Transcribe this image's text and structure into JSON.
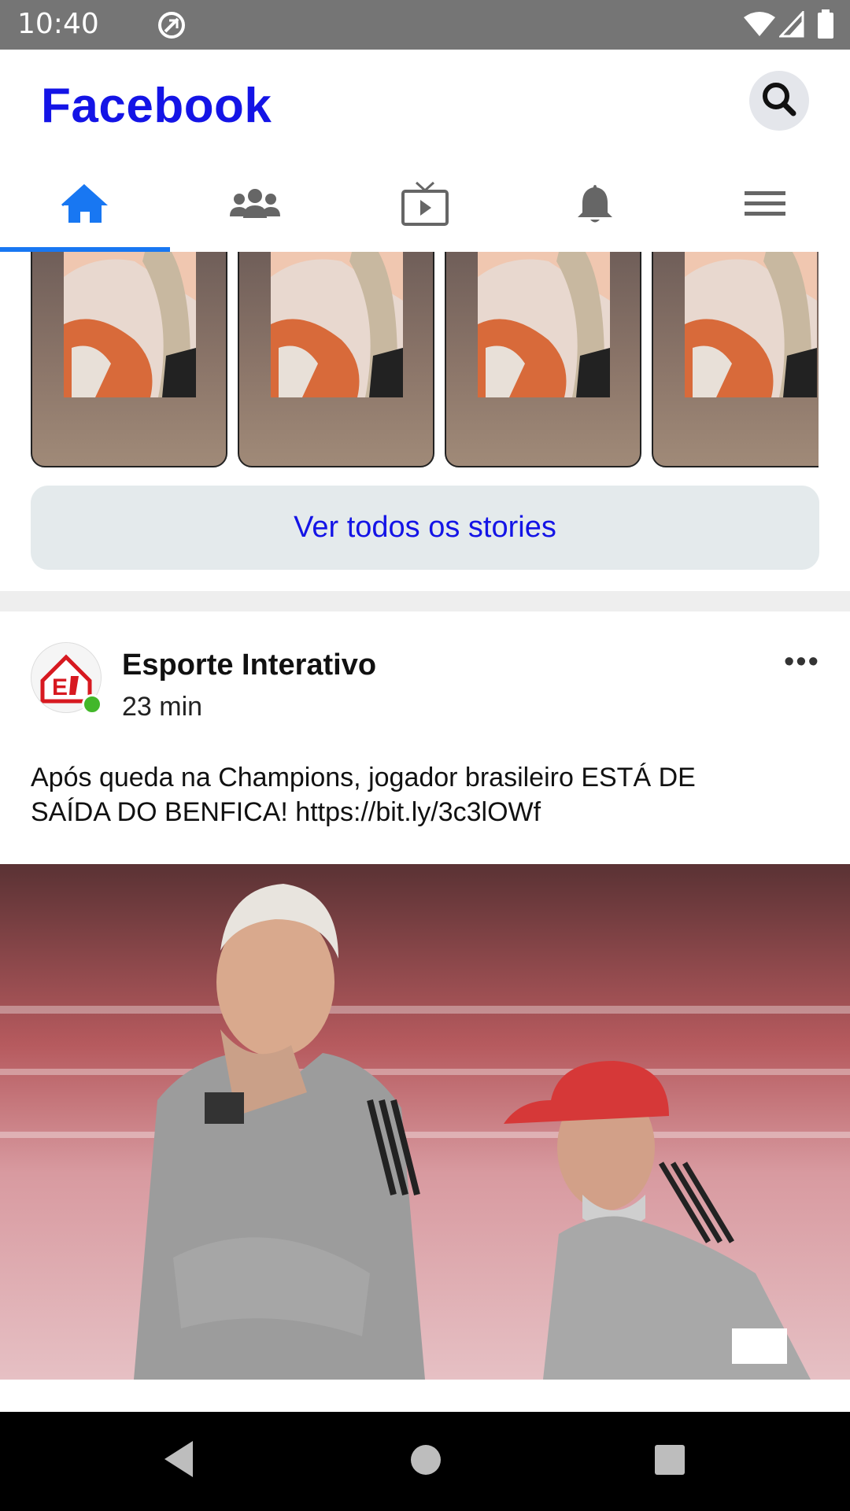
{
  "status_bar": {
    "time": "10:40",
    "icons": [
      "data-saver-icon",
      "wifi-icon",
      "cellular-signal-icon",
      "battery-icon"
    ]
  },
  "header": {
    "title": "Facebook",
    "search_icon": "search-icon",
    "brand_color": "#1414e6"
  },
  "tabs": [
    {
      "name": "home",
      "icon": "home-icon",
      "active": true
    },
    {
      "name": "groups",
      "icon": "people-icon",
      "active": false
    },
    {
      "name": "watch",
      "icon": "tv-play-icon",
      "active": false
    },
    {
      "name": "notifications",
      "icon": "bell-icon",
      "active": false
    },
    {
      "name": "menu",
      "icon": "hamburger-menu-icon",
      "active": false
    }
  ],
  "stories": {
    "see_all_label": "Ver todos os stories"
  },
  "post": {
    "author": "Esporte Interativo",
    "time": "23 min",
    "more_icon": "more-options-icon",
    "text_line1": "Após queda na Champions, jogador brasileiro ESTÁ DE",
    "text_line2": "SAÍDA DO BENFICA! https://bit.ly/3c3lOWf"
  },
  "nav": {
    "back": "back-icon",
    "home": "home-circle-icon",
    "recents": "recents-square-icon"
  }
}
